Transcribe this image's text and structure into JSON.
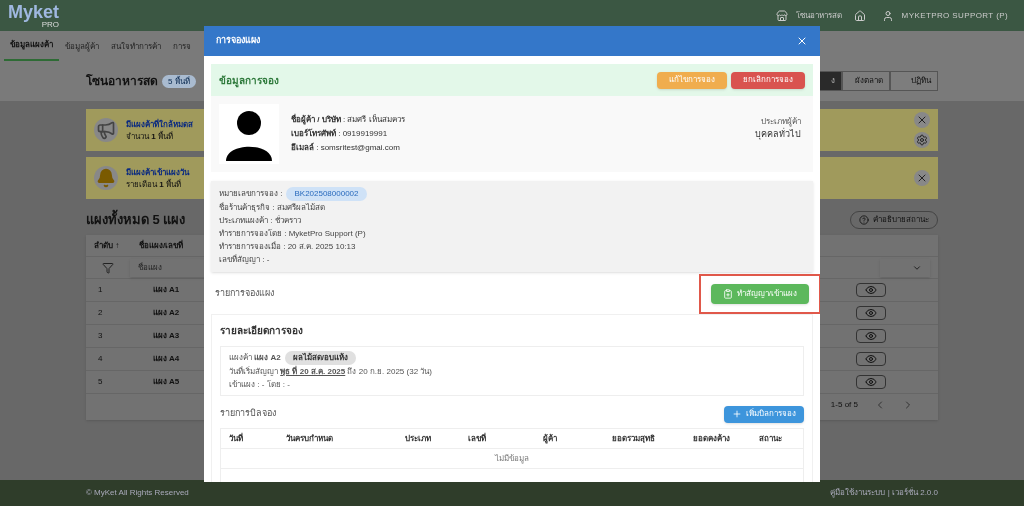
{
  "header": {
    "logo": "Myket",
    "logo_sub": "PRO",
    "zone": "โซนอาหารสด",
    "user": "MYKETPRO SUPPORT (P)"
  },
  "tabs": [
    {
      "label": "ข้อมูลแผงค้า",
      "selected": true
    },
    {
      "label": "ข้อมูลผู้ค้า",
      "selected": false
    },
    {
      "label": "สนใจทำการค้า",
      "selected": false
    },
    {
      "label": "การจ",
      "selected": false
    }
  ],
  "zone": {
    "title": "โซนอาหารสด",
    "badge": "5 พื้นที่"
  },
  "view_buttons": [
    {
      "label": "ง",
      "selected": true
    },
    {
      "label": "ผังตลาด",
      "selected": false
    },
    {
      "label": "ปฏิทิน",
      "selected": false
    }
  ],
  "alerts": [
    {
      "kind": "megaphone",
      "title": "มีแผงค้าที่ใกล้หมดส",
      "detail": "จำนวน **1** พื้นที่",
      "settings": true
    },
    {
      "kind": "bell",
      "title": "มีแผงค้าเข้าแผงวัน",
      "detail": "รายเดือน **1** พื้นที่",
      "settings": false
    }
  ],
  "stalls": {
    "title": "แผงทั้งหมด 5 แผง",
    "legend_button": "คำอธิบายสถานะ",
    "columns": [
      "ลำดับ ↑",
      "ชื่อแผง/เลขที่"
    ],
    "filter_placeholder": "ชื่อแผง",
    "rows": [
      {
        "no": "1",
        "name": "แผง A1"
      },
      {
        "no": "2",
        "name": "แผง A2"
      },
      {
        "no": "3",
        "name": "แผง A3"
      },
      {
        "no": "4",
        "name": "แผง A4"
      },
      {
        "no": "5",
        "name": "แผง A5"
      }
    ],
    "pagination": "1-5 of 5"
  },
  "footer": {
    "left": "© MyKet All Rights Reserved",
    "right": "คู่มือใช้งานระบบ | เวอร์ชั่น 2.0.0"
  },
  "modal": {
    "title": "การจองแผง",
    "info": {
      "title": "ข้อมูลการจอง",
      "edit_button": "แก้ไขการจอง",
      "cancel_button": "ยกเลิกการจอง",
      "person_lines": [
        "**ชื่อผู้ค้า / บริษัท** : สมศรี เห็นสมควร",
        "**เบอร์โทรศัพท์** : 0919919991",
        "**อีเมลล์** : somsritest@gmai.com"
      ],
      "trader_type_label": "ประเภทผู้ค้า",
      "trader_type": "บุคคลทั่วไป",
      "booking_no_label": "หมายเลขการจอง :",
      "booking_no": "BK202508000002",
      "booking_lines": [
        "ชื่อร้านค้าธุรกิจ : สมศรีผลไม้สด",
        "ประเภทแผงค้า : ชั่วคราว",
        "ทำรายการจองโดย : MyketPro Support (P)",
        "ทำรายการจองเมื่อ : 20 ส.ค. 2025 10:13",
        "เลขที่สัญญา : -"
      ]
    },
    "stall_section": "รายการจองแผง",
    "contract_button": "ทำสัญญา/เข้าแผง",
    "highlighted": true,
    "detail": {
      "title": "รายละเอียดการจอง",
      "stall_line": "แผงค้า **แผง A2**",
      "category": "ผลไม้สด/อบแห้ง",
      "date_line": "วันที่เริ่มสัญญา **พุธ ที่ 20 ส.ค. 2025** ถึง 20 ก.ย. 2025 (32 วัน)",
      "entry_line": "เข้าแผง : - โดย : -"
    },
    "bills": {
      "title": "รายการบิลจอง",
      "add_button": "เพิ่มบิลการจอง",
      "columns": [
        "วันที่",
        "วันครบกำหนด",
        "ประเภท",
        "เลขที่",
        "ผู้ค้า",
        "ยอดรวมสุทธิ",
        "ยอดคงค้าง",
        "สถานะ"
      ],
      "empty": "ไม่มีข้อมูล"
    }
  }
}
